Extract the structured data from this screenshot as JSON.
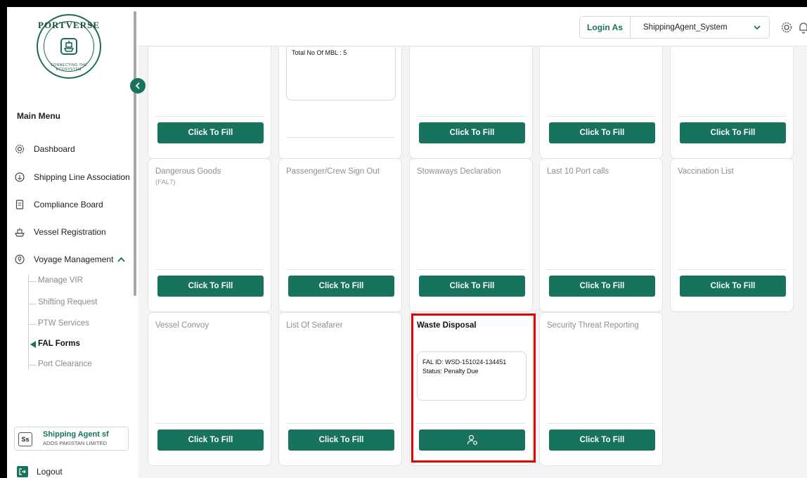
{
  "brand": {
    "logo_top": "PORTVERSE",
    "logo_bottom": "CONNECTING THE ECOSYSTEM"
  },
  "sidebar": {
    "menu_title": "Main Menu",
    "items": [
      {
        "label": "Dashboard",
        "icon": "gear-icon"
      },
      {
        "label": "Shipping Line Association",
        "icon": "anchor-circle-icon"
      },
      {
        "label": "Compliance Board",
        "icon": "document-icon"
      },
      {
        "label": "Vessel Registration",
        "icon": "ship-icon"
      },
      {
        "label": "Voyage Management",
        "icon": "location-pin-icon",
        "expanded": true
      }
    ],
    "sub_items": [
      "Manage VIR",
      "Shifting Request",
      "PTW Services",
      "FAL Forms",
      "Port Clearance"
    ],
    "active_sub": "FAL Forms",
    "profile": {
      "initials": "Ss",
      "name": "Shipping Agent sf",
      "company": "ADOS PAKISTAN LIMITED"
    },
    "logout": "Logout"
  },
  "header": {
    "login_label": "Login As",
    "login_value": "ShippingAgent_System"
  },
  "cards": {
    "row1": [
      {
        "title": "",
        "button": "Click To Fill"
      },
      {
        "title": "",
        "info": "Total No Of MBL : 5"
      },
      {
        "title": "",
        "button": "Click To Fill"
      },
      {
        "title": "",
        "button": "Click To Fill"
      },
      {
        "title": "",
        "button": "Click To Fill"
      }
    ],
    "row2": [
      {
        "title": "Dangerous Goods",
        "subtitle": "(FAL7)",
        "button": "Click To Fill"
      },
      {
        "title": "Passenger/Crew Sign Out",
        "button": "Click To Fill"
      },
      {
        "title": "Stowaways Declaration",
        "button": "Click To Fill"
      },
      {
        "title": "Last 10 Port calls",
        "button": "Click To Fill"
      },
      {
        "title": "Vaccination List",
        "button": "Click To Fill"
      }
    ],
    "row3": [
      {
        "title": "Vessel Convoy",
        "button": "Click To Fill"
      },
      {
        "title": "List Of Seafarer",
        "button": "Click To Fill"
      },
      {
        "title": "Waste Disposal",
        "fal_id": "FAL ID: WSD-151024-134451",
        "status": "Status: Penalty Due",
        "button_icon": "user-settings-icon"
      },
      {
        "title": "Security Threat Reporting",
        "button": "Click To Fill"
      }
    ]
  },
  "colors": {
    "primary": "#17735d",
    "highlight": "#e10000"
  }
}
